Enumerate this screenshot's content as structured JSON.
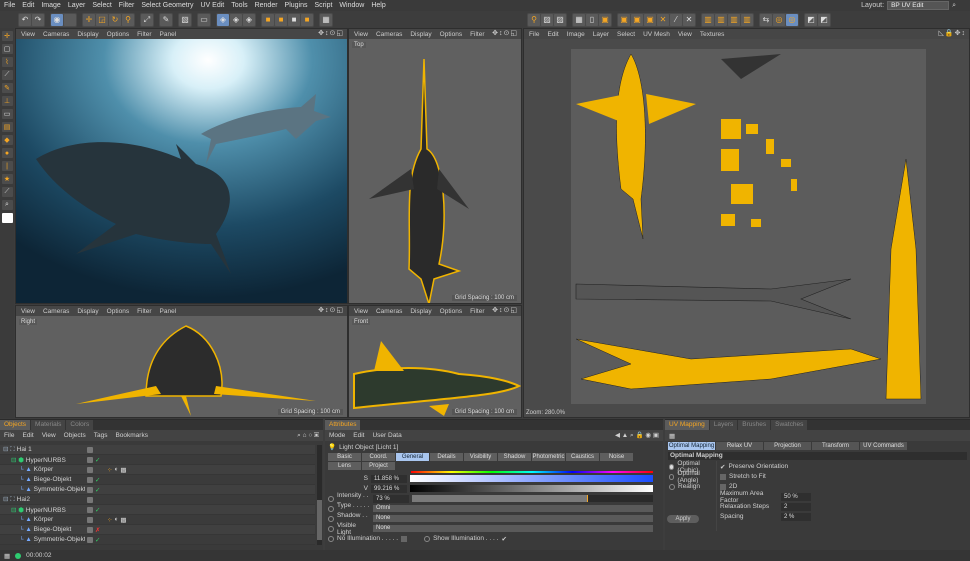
{
  "menubar": {
    "items": [
      "File",
      "Edit",
      "Image",
      "Layer",
      "Select",
      "Filter",
      "Select Geometry",
      "UV Edit",
      "Tools",
      "Render",
      "Plugins",
      "Script",
      "Window",
      "Help"
    ],
    "layout_label": "Layout:",
    "layout_value": "BP UV Edit"
  },
  "viewports": {
    "menu": [
      "View",
      "Cameras",
      "Display",
      "Options",
      "Filter",
      "Panel"
    ],
    "perspective": {
      "label": ""
    },
    "top": {
      "label": "Top",
      "grid": "Grid Spacing : 100 cm"
    },
    "right": {
      "label": "Right",
      "grid": "Grid Spacing : 100 cm"
    },
    "front": {
      "label": "Front",
      "grid": "Grid Spacing : 100 cm"
    }
  },
  "uv_editor": {
    "menu": [
      "File",
      "Edit",
      "Image",
      "Layer",
      "Select",
      "UV Mesh",
      "View",
      "Textures"
    ],
    "zoom": "Zoom: 280.0%"
  },
  "objects_panel": {
    "tabs": [
      "Objects",
      "Materials",
      "Colors"
    ],
    "menu": [
      "File",
      "Edit",
      "View",
      "Objects",
      "Tags",
      "Bookmarks"
    ],
    "rows": [
      {
        "name": "Hai 1",
        "indent": 0,
        "check": ""
      },
      {
        "name": "HyperNURBS",
        "indent": 1,
        "check": "✓"
      },
      {
        "name": "Körper",
        "indent": 2,
        "check": ""
      },
      {
        "name": "Biege-Objekt",
        "indent": 2,
        "check": "✓"
      },
      {
        "name": "Symmetrie-Objekt",
        "indent": 2,
        "check": "✓"
      },
      {
        "name": "Hai2",
        "indent": 0,
        "check": ""
      },
      {
        "name": "HyperNURBS",
        "indent": 1,
        "check": "✓"
      },
      {
        "name": "Körper",
        "indent": 2,
        "check": ""
      },
      {
        "name": "Biege-Objekt",
        "indent": 2,
        "check": "✗"
      },
      {
        "name": "Symmetrie-Objekt",
        "indent": 2,
        "check": "✓"
      }
    ]
  },
  "attributes": {
    "tab": "Attributes",
    "menu": [
      "Mode",
      "Edit",
      "User Data"
    ],
    "object": "Light Object [Licht 1]",
    "tabs": [
      "Basic",
      "Coord.",
      "General",
      "Details",
      "Visibility",
      "Shadow",
      "Photometric",
      "Caustics",
      "Noise",
      "Lens",
      "Project"
    ],
    "active_tab": "General",
    "s_label": "S",
    "s_value": "11.858 %",
    "v_label": "V",
    "v_value": "99.216 %",
    "intensity_label": "Intensity . . .",
    "intensity_value": "73 %",
    "intensity_fraction": 0.73,
    "type_label": "Type . . . . . . .",
    "type_value": "Omni",
    "shadow_label": "Shadow . . . .",
    "shadow_value": "None",
    "visible_light_label": "Visible Light",
    "visible_light_value": "None",
    "no_illumination": "No Illumination . . . . .",
    "show_illumination": "Show Illumination . . . ."
  },
  "uv_mapping": {
    "tabs": [
      "UV Mapping",
      "Layers",
      "Brushes",
      "Swatches"
    ],
    "subtabs": [
      "Optimal Mapping",
      "Relax UV",
      "Projection",
      "Transform",
      "UV Commands"
    ],
    "section": "Optimal Mapping",
    "radios": [
      "Optimal (Cubic)",
      "Optimal (Angle)",
      "Realign"
    ],
    "checks": [
      {
        "label": "Preserve Orientation",
        "checked": true
      },
      {
        "label": "Stretch to Fit",
        "checked": false
      },
      {
        "label": "2D",
        "checked": false
      }
    ],
    "fields": [
      {
        "label": "Maximum Area Factor",
        "value": "50 %"
      },
      {
        "label": "Relaxation Steps",
        "value": "2"
      },
      {
        "label": "Spacing",
        "value": "2 %"
      }
    ],
    "apply": "Apply"
  },
  "status": {
    "time": "00:00:02"
  },
  "colors": {
    "accent": "#f5a623",
    "selection": "#a9c6ef",
    "wire": "#f0b400"
  }
}
